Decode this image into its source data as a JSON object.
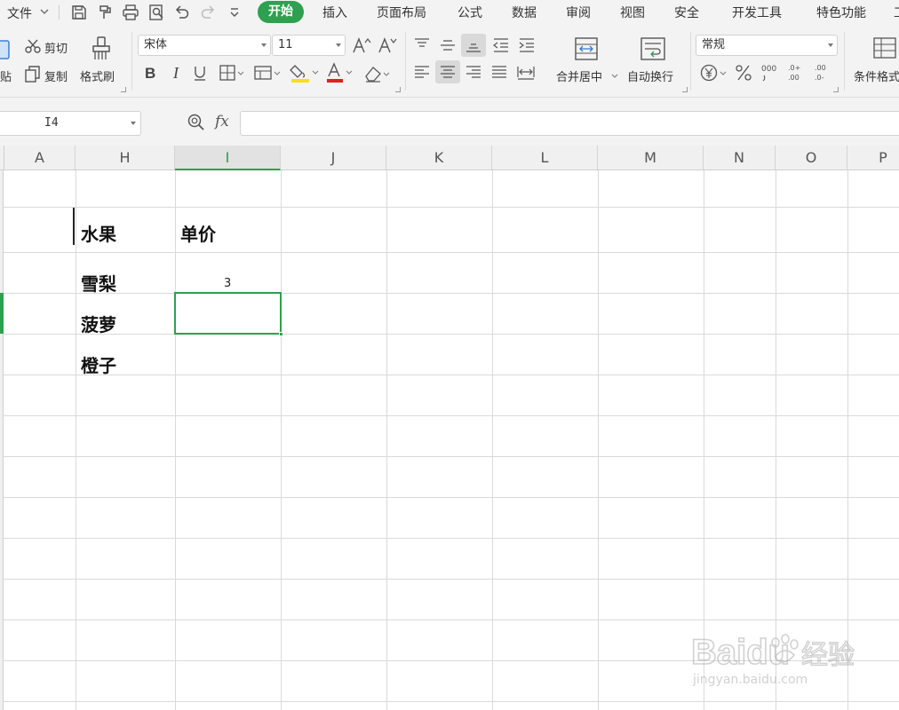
{
  "menubar": {
    "file_label": "文件",
    "tabs": [
      "开始",
      "插入",
      "页面布局",
      "公式",
      "数据",
      "审阅",
      "视图",
      "安全",
      "开发工具",
      "特色功能"
    ],
    "active_tab": "开始",
    "quick_icons": [
      "save-icon",
      "format-painter-icon",
      "print-icon",
      "print-preview-icon",
      "undo-icon",
      "redo-icon",
      "customize-chevron-icon"
    ]
  },
  "ribbon": {
    "paste_label_partial": "贴",
    "cut_label": "剪切",
    "copy_label": "复制",
    "format_painter_label": "格式刷",
    "font_name": "宋体",
    "font_size": "11",
    "merge_center_label": "合并居中",
    "wrap_text_label": "自动换行",
    "number_format": "常规",
    "conditional_format_label_partial": "条件格式",
    "font_color": "#e02020",
    "fill_color": "#f5e01a"
  },
  "formula_bar": {
    "cell_ref": "I4",
    "fx_label": "fx",
    "formula_value": ""
  },
  "sheet": {
    "columns": [
      "A",
      "H",
      "I",
      "J",
      "K",
      "L",
      "M",
      "N",
      "O",
      "P"
    ],
    "selected_column": "I",
    "cells": {
      "h2": "水果",
      "i2": "单价",
      "h3": "雪梨",
      "i3": "3",
      "h4": "菠萝",
      "h5": "橙子"
    },
    "selected_cell": "I4",
    "accent_color": "#2ea04f"
  },
  "watermark": {
    "brand": "Baidu",
    "brand_suffix": "经验",
    "url": "jingyan.baidu.com"
  }
}
